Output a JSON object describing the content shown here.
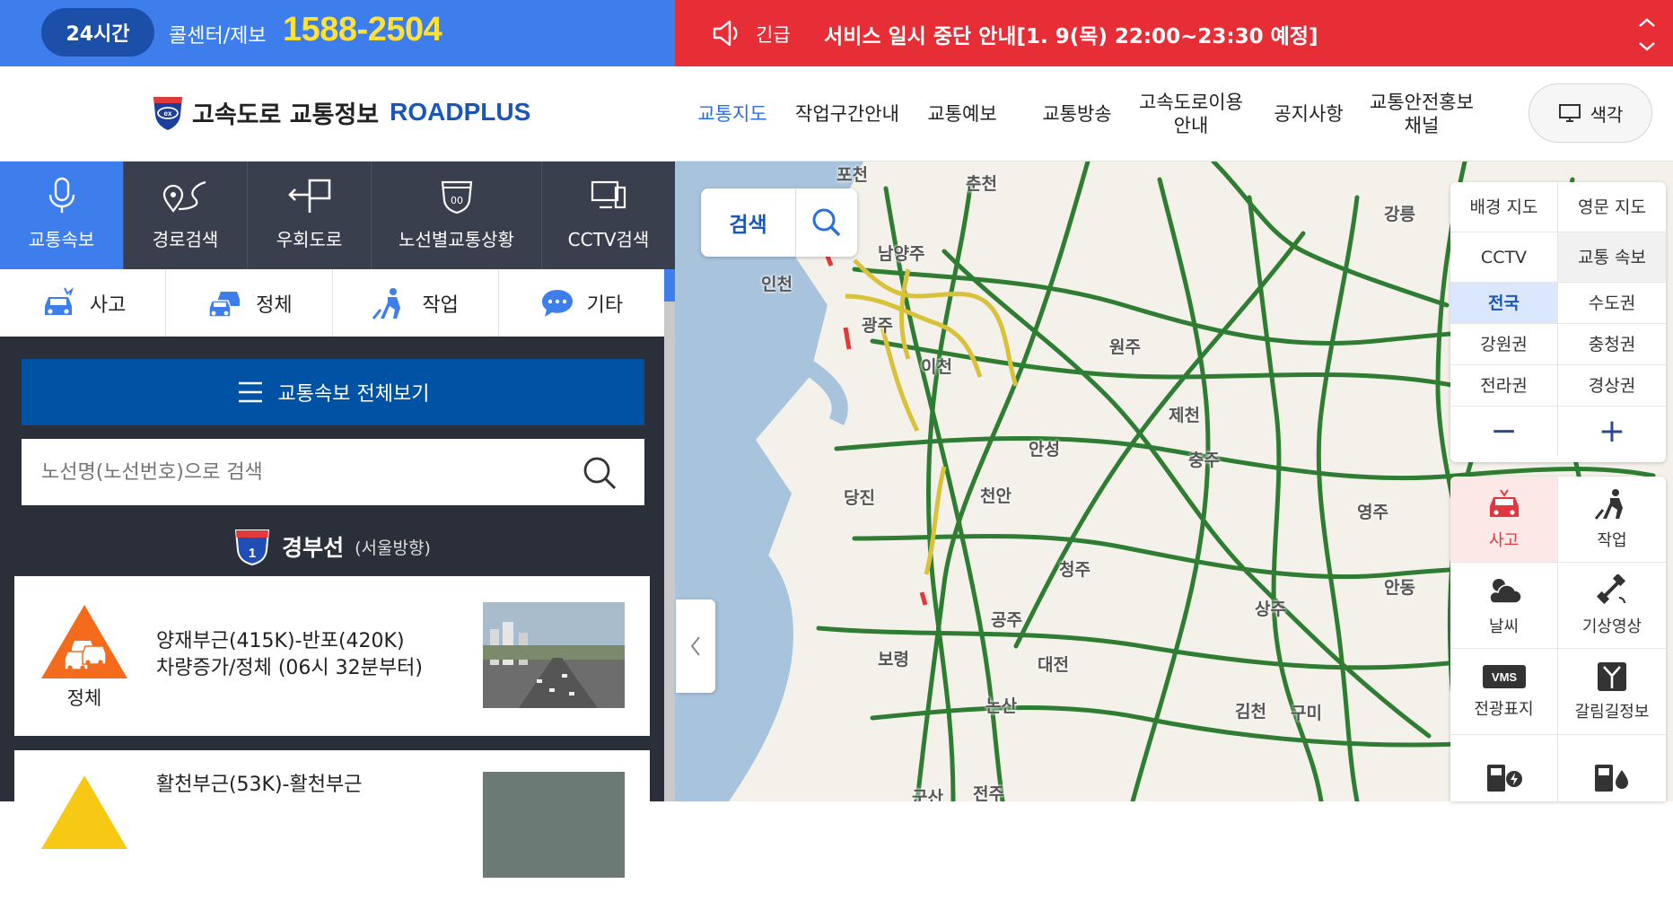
{
  "topbar": {
    "badge": "24시간",
    "callcenter": "콜센터/제보",
    "phone": "1588-2504",
    "urgent": "긴급",
    "notice": "서비스 일시 중단 안내[1. 9(목) 22:00~23:30 예정]"
  },
  "header": {
    "logo_kr": "고속도로 교통정보",
    "logo_en": "ROADPLUS",
    "nav": [
      {
        "label": "교통지도"
      },
      {
        "label": "작업구간안내"
      },
      {
        "label": "교통예보"
      },
      {
        "label": "교통방송"
      },
      {
        "label": "고속도로이용 안내"
      },
      {
        "label": "공지사항"
      },
      {
        "label": "교통안전홍보 채널"
      }
    ],
    "color_button": "색각"
  },
  "tabs": [
    "교통속보",
    "경로검색",
    "우회도로",
    "노선별교통상황",
    "CCTV검색"
  ],
  "categories": [
    "사고",
    "정체",
    "작업",
    "기타"
  ],
  "panel": {
    "all_view": "교통속보 전체보기",
    "search_placeholder": "노선명(노선번호)으로 검색",
    "route_number": "1",
    "route_name": "경부선",
    "route_dir": "(서울방향)",
    "cards": [
      {
        "type": "정체",
        "line1": "양재부근(415K)-반포(420K)",
        "line2": "차량증가/정체 (06시 32분부터)"
      },
      {
        "type": "",
        "line1": "활천부근(53K)-활천부근",
        "line2": ""
      }
    ]
  },
  "map": {
    "search_label": "검색",
    "controls": [
      "배경 지도",
      "영문 지도",
      "CCTV",
      "교통 속보",
      "전국",
      "수도권",
      "강원권",
      "충청권",
      "전라권",
      "경상권"
    ],
    "zoom_out": "−",
    "zoom_in": "+",
    "tools": [
      "사고",
      "작업",
      "날씨",
      "기상영상",
      "전광표지",
      "갈림길정보"
    ],
    "places": [
      "포천",
      "춘천",
      "강릉",
      "남양주",
      "인천",
      "광주",
      "원주",
      "이천",
      "제천",
      "안성",
      "충주",
      "당진",
      "천안",
      "영주",
      "청주",
      "안동",
      "공주",
      "상주",
      "보령",
      "대전",
      "논산",
      "김천",
      "구미",
      "군산",
      "전주"
    ]
  },
  "colors": {
    "blue": "#3d7eec",
    "red": "#e72e36",
    "phone_yellow": "#ffe137",
    "road_green": "#2e7d32"
  }
}
